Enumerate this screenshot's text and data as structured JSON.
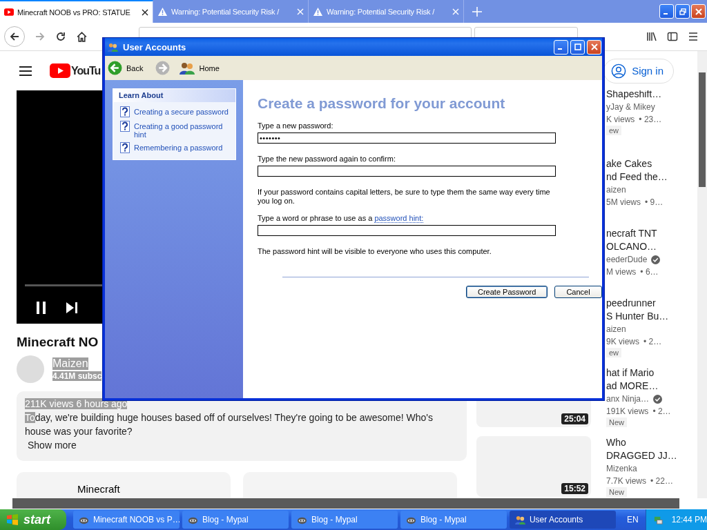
{
  "browser": {
    "tabs": [
      {
        "label": "Minecraft NOOB vs PRO: STATUE",
        "selected": true
      },
      {
        "label": "Warning: Potential Security Risk /",
        "selected": false
      },
      {
        "label": "Warning: Potential Security Risk /",
        "selected": false
      }
    ]
  },
  "youtube": {
    "logo": "YouTu",
    "sign_in": "Sign in",
    "video_title": "Minecraft NO",
    "channel": {
      "name": "Maizen",
      "subscribers": "4.41M subsc"
    },
    "description": {
      "stats": "211K views  6 hours ago",
      "highlighted": "To",
      "text": "day, we're building huge houses based off of ourselves! They're going to be awesome! Who's house was your favorite?",
      "more": "Show more"
    },
    "cards": [
      {
        "title": "Minecraft"
      }
    ],
    "related": [
      {
        "title": [
          "Shapeshift…"
        ],
        "channel": "yJay & Mikey",
        "verified": false,
        "views": "K views",
        "age": "• 23…",
        "new": "ew"
      },
      {
        "title": [
          "ake Cakes",
          "nd Feed the…"
        ],
        "channel": "aizen",
        "verified": false,
        "views": "5M views",
        "age": "• 9…"
      },
      {
        "title": [
          "necraft TNT",
          "OLCANO…"
        ],
        "channel": "eederDude",
        "verified": true,
        "views": "M views",
        "age": "• 6…"
      },
      {
        "title": [
          "peedrunner",
          "S Hunter Bu…"
        ],
        "channel": "aizen",
        "verified": false,
        "views": "9K views",
        "age": "• 2…",
        "new": "ew"
      },
      {
        "title": [
          "hat if Mario",
          "ad MORE…"
        ],
        "channel": "anx Ninja…",
        "verified": true,
        "views": "191K views",
        "age": "• 2…",
        "new": "New",
        "duration": "25:04"
      },
      {
        "title": [
          "Who",
          "DRAGGED JJ…"
        ],
        "channel": "Mizenka",
        "verified": false,
        "views": "7.7K views",
        "age": "• 22…",
        "new": "New",
        "duration": "15:52"
      }
    ]
  },
  "dialog": {
    "title": "User Accounts",
    "back": "Back",
    "home": "Home",
    "learn_about": {
      "heading": "Learn About",
      "links": [
        "Creating a secure password",
        "Creating a good password hint",
        "Remembering a password"
      ]
    },
    "heading": "Create a password for your account",
    "new_password": {
      "label": "Type a new password:",
      "value": "•••••••"
    },
    "confirm_password": {
      "label": "Type the new password again to confirm:"
    },
    "note": "If your password contains capital letters, be sure to type them the same way every time you log on.",
    "hint": {
      "label": "Type a word or phrase to use as a",
      "link": "password hint:"
    },
    "footnote": "The password hint will be visible to everyone who uses this computer.",
    "buttons": [
      {
        "label": "Create Password",
        "default": true
      },
      {
        "label": "Cancel",
        "default": false
      }
    ]
  },
  "taskbar": {
    "start": "start",
    "tasks": [
      {
        "label": "Minecraft NOOB vs P…",
        "selected": false
      },
      {
        "label": "Blog - Mypal",
        "selected": false
      },
      {
        "label": "Blog - Mypal",
        "selected": false
      },
      {
        "label": "Blog - Mypal",
        "selected": false
      },
      {
        "label": "User Accounts",
        "selected": true
      }
    ],
    "language": "EN",
    "clock": "12:44 PM"
  }
}
